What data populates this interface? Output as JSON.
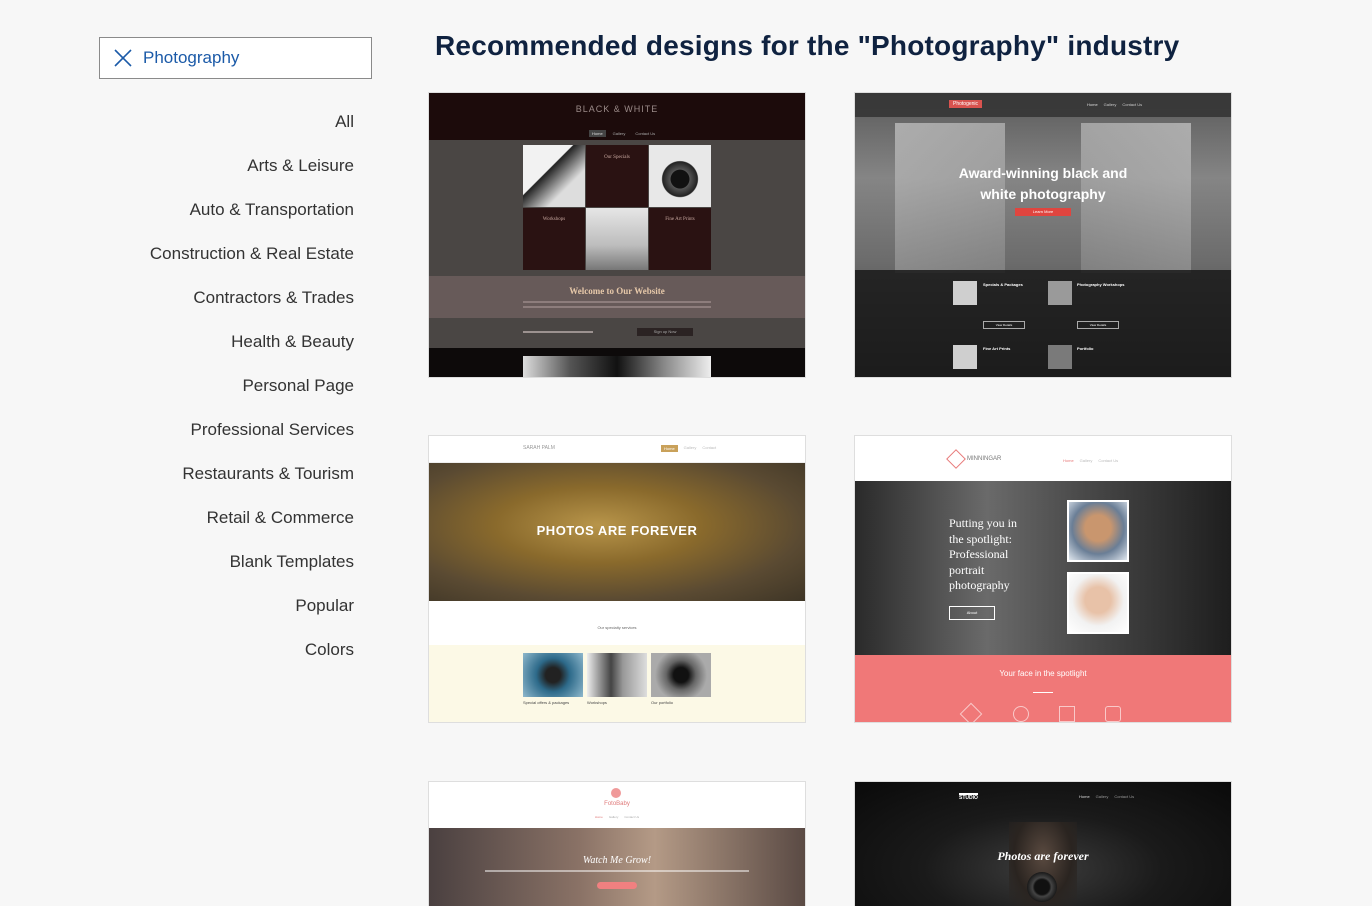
{
  "search": {
    "value": "Photography",
    "clear_icon": "close-icon"
  },
  "categories": [
    "All",
    "Arts & Leisure",
    "Auto & Transportation",
    "Construction & Real Estate",
    "Contractors & Trades",
    "Health & Beauty",
    "Personal Page",
    "Professional Services",
    "Restaurants & Tourism",
    "Retail & Commerce",
    "Blank Templates",
    "Popular",
    "Colors"
  ],
  "heading": "Recommended designs for the \"Photography\" industry",
  "templates": [
    {
      "logo": "BLACK & WHITE",
      "nav": [
        "Home",
        "Gallery",
        "Contact Us"
      ],
      "tiles": [
        "Our Specials",
        "Workshops",
        "Fine Art Prints"
      ],
      "banner_title": "Welcome to Our Website",
      "cta": "Sign up Now"
    },
    {
      "logo": "Photogenic",
      "nav": [
        "Home",
        "Gallery",
        "Contact Us"
      ],
      "hero_line1": "Award-winning black and",
      "hero_line2": "white photography",
      "hero_button": "Learn More",
      "items": [
        "Specials & Packages",
        "Photography Workshops",
        "Fine Art Prints",
        "Portfolio"
      ],
      "item_button": "View Details"
    },
    {
      "logo": "SARAH PALM",
      "nav": [
        "Home",
        "Gallery",
        "Contact"
      ],
      "hero_title": "PHOTOS ARE FOREVER",
      "section_label": "Our specialty services",
      "captions": [
        "Special offers & packages",
        "Workshops",
        "Our portfolio"
      ]
    },
    {
      "logo": "MINNINGAR",
      "nav": [
        "Home",
        "Gallery",
        "Contact Us"
      ],
      "hero_lines": [
        "Putting you in",
        "the spotlight:",
        "Professional",
        "portrait",
        "photography"
      ],
      "hero_button": "About",
      "band_title": "Your face in the spotlight"
    },
    {
      "logo": "FotoBaby",
      "nav": [
        "Home",
        "Gallery",
        "Contact Us"
      ],
      "hero_title": "Watch Me Grow!"
    },
    {
      "logo": "STUDIO",
      "nav": [
        "Home",
        "Gallery",
        "Contact Us"
      ],
      "hero_title": "Photos are forever"
    }
  ]
}
